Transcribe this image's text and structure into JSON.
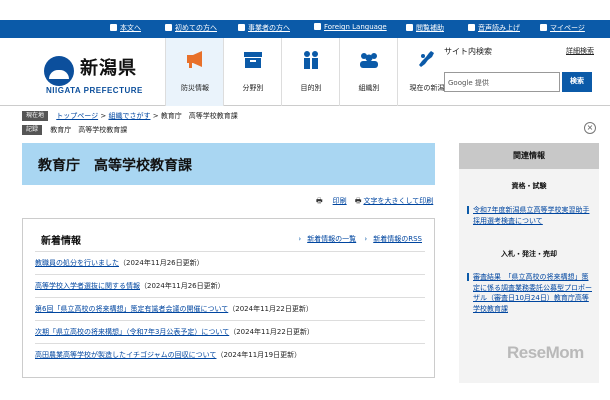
{
  "topbar": {
    "items": [
      "本文へ",
      "初めての方へ",
      "事業者の方へ",
      "Foreign Language",
      "閲覧補助",
      "音声読み上げ",
      "マイページ"
    ]
  },
  "logo": {
    "jp": "新潟県",
    "en": "NIIGATA PREFECTURE"
  },
  "nav": [
    {
      "label": "防災情報",
      "icon": "megaphone-icon"
    },
    {
      "label": "分野別",
      "icon": "box-icon"
    },
    {
      "label": "目的別",
      "icon": "people-icon"
    },
    {
      "label": "組織別",
      "icon": "group-icon"
    },
    {
      "label": "現在の新潟",
      "icon": "map-icon"
    }
  ],
  "search": {
    "title": "サイト内検索",
    "detail": "詳細検索",
    "placeholder": "Google 提供",
    "button": "検索"
  },
  "breadcrumb": {
    "current_tag": "現在地",
    "items": [
      "トップページ",
      "組織でさがす",
      "教育庁　高等学校教育課"
    ],
    "records_tag": "記録",
    "records_text": "教育庁　高等学校教育課"
  },
  "page": {
    "title": "教育庁　高等学校教育課",
    "print": "印刷",
    "enlarge": "文字を大きくして印刷"
  },
  "news": {
    "heading": "新着情報",
    "list_link": "新着情報の一覧",
    "rss_link": "新着情報のRSS",
    "items": [
      {
        "link": "教職員の処分を行いました",
        "date": "（2024年11月26日更新）"
      },
      {
        "link": "高等学校入学者選抜に関する情報",
        "date": "（2024年11月26日更新）"
      },
      {
        "link": "第6回「県立高校の将来構想」策定有識者会議の開催について",
        "date": "（2024年11月22日更新）"
      },
      {
        "link": "次期「県立高校の将来構想」（令和7年3月公表予定）について",
        "date": "（2024年11月22日更新）"
      },
      {
        "link": "高田農業高等学校が製造したイチゴジャムの回収について",
        "date": "（2024年11月19日更新）"
      }
    ]
  },
  "sidebar": {
    "heading": "関連情報",
    "sections": [
      {
        "title": "資格・試験",
        "links": [
          "令和7年度新潟県立高等学校実習助手採用選考検査について"
        ]
      },
      {
        "title": "入札・発注・売却",
        "links": [
          "審査結果　「県立高校の将来構想」策定に係る調査業務委託公募型プロポーザル（審査日10月24日）教育庁高等学校教育課"
        ]
      }
    ]
  },
  "watermark": "ReseMom"
}
